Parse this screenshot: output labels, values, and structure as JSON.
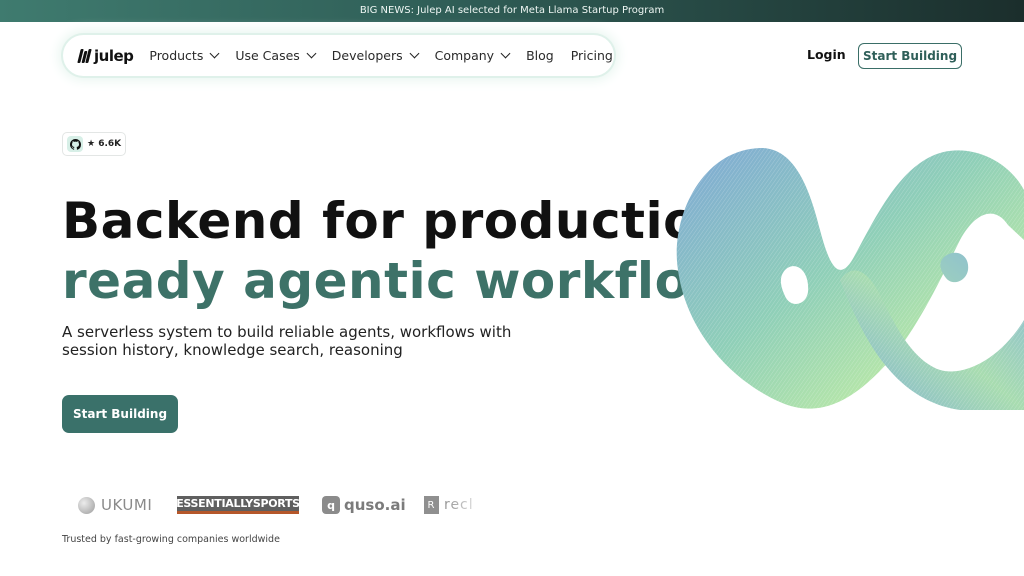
{
  "announcement": {
    "text": "BIG NEWS: Julep AI selected for Meta Llama Startup Program"
  },
  "nav": {
    "logo_text": "julep",
    "items": [
      {
        "label": "Products",
        "has_dropdown": true
      },
      {
        "label": "Use Cases",
        "has_dropdown": true
      },
      {
        "label": "Developers",
        "has_dropdown": true
      },
      {
        "label": "Company",
        "has_dropdown": true
      },
      {
        "label": "Blog",
        "has_dropdown": false
      },
      {
        "label": "Pricing",
        "has_dropdown": false
      }
    ],
    "login_label": "Login",
    "start_label": "Start Building"
  },
  "github": {
    "icon": "github-icon",
    "stars": "★ 6.6K"
  },
  "hero": {
    "title_line1": "Backend for production",
    "title_line2": "ready agentic workflows",
    "subtitle": "A serverless system to build reliable agents, workflows with session history, knowledge search, reasoning",
    "cta_label": "Start Building"
  },
  "logos": {
    "ukumi": "UKUMI",
    "essentiallysports": "ESSENTIALLYSPORTS",
    "quso": "quso.ai",
    "quso_mark": "q",
    "recl": "recl",
    "recl_mark": "R"
  },
  "trusted_text": "Trusted by fast-growing companies worldwide",
  "colors": {
    "accent": "#3a716a",
    "headline_accent": "#3d7268",
    "announce_start": "#3f7b6f",
    "announce_end": "#1b2e2c"
  }
}
